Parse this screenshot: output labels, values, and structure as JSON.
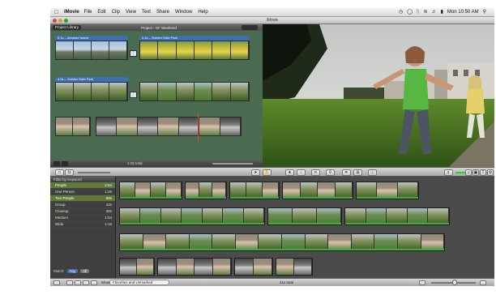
{
  "menubar": {
    "app_name": "iMovie",
    "items": [
      "File",
      "Edit",
      "Clip",
      "View",
      "Text",
      "Share",
      "Window",
      "Help"
    ],
    "clock": "Mon 10:50 AM"
  },
  "window": {
    "title": "iMovie"
  },
  "project_library": {
    "library_button": "Project Library",
    "title": "Project - SF Weekend",
    "clips": [
      {
        "label": "5.1s – Alcatraz Island"
      },
      {
        "label": "4.4s – Golden Gate Park"
      },
      {
        "label": "4.0s – Golden Gate Park"
      }
    ],
    "total": "1:15 total"
  },
  "toolbar": {
    "buttons": [
      "arrow",
      "hand",
      "star",
      "unstar",
      "reject",
      "keyword",
      "eyedropper",
      "crop",
      "info"
    ]
  },
  "event_library": {
    "header": "Filter by Keyword",
    "keywords": [
      {
        "name": "People",
        "value": "2:54"
      },
      {
        "name": "One Person",
        "value": "1:26"
      },
      {
        "name": "Two People",
        "value": "59s"
      },
      {
        "name": "Group",
        "value": "43s"
      },
      {
        "name": "Closeup",
        "value": "38s"
      },
      {
        "name": "Medium",
        "value": "1:54"
      },
      {
        "name": "Wide",
        "value": "1:18"
      }
    ],
    "match_label": "Match:",
    "match_any": "Any",
    "match_all": "All"
  },
  "bottom_bar": {
    "show_label": "Show:",
    "show_value": "Favorites and Unmarked",
    "total": "41s total"
  }
}
